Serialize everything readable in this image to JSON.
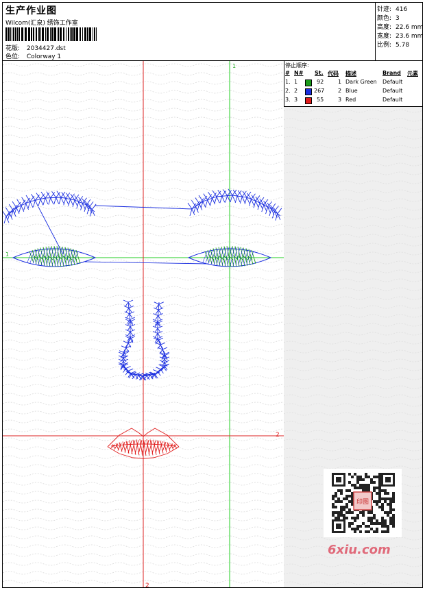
{
  "header": {
    "title": "生产作业图",
    "company": "Wilcom(汇泉) 绣饰工作室",
    "design_label": "花版:",
    "design_value": "2034427.dst",
    "colorway_label": "色位:",
    "colorway_value": "Colorway 1"
  },
  "stats": [
    {
      "label": "针迹:",
      "value": "416"
    },
    {
      "label": "颜色:",
      "value": "3"
    },
    {
      "label": "高度:",
      "value": "22.6 mm"
    },
    {
      "label": "宽度:",
      "value": "23.6 mm"
    },
    {
      "label": "比例:",
      "value": "5.78"
    }
  ],
  "sequence": {
    "title": "停止顺序:",
    "columns": [
      "#",
      "N#",
      "St.",
      "代码",
      "描述",
      "Brand",
      "元素"
    ],
    "rows": [
      {
        "idx": "1.",
        "n": "1",
        "color": "#1a9a1a",
        "st": "92",
        "code": "1",
        "desc": "Dark Green",
        "brand": "Default"
      },
      {
        "idx": "2.",
        "n": "2",
        "color": "#1a2ee0",
        "st": "267",
        "code": "2",
        "desc": "Blue",
        "brand": "Default"
      },
      {
        "idx": "3.",
        "n": "3",
        "color": "#e01a1a",
        "st": "55",
        "code": "3",
        "desc": "Red",
        "brand": "Default"
      }
    ]
  },
  "guides": {
    "green_v_label": "1",
    "green_h_label": "1",
    "red_v_label": "2",
    "red_h_label": "2"
  },
  "thread_colors": {
    "green": "#1a9a1a",
    "blue": "#1a2ee0",
    "red": "#e01a1a"
  },
  "watermark": {
    "text": "6xiu.com",
    "seal_text": "印图"
  }
}
